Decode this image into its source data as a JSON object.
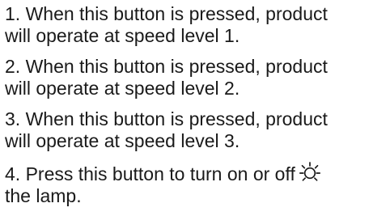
{
  "instructions": [
    {
      "line1": "1. When this button is pressed, product",
      "line2": "will  operate at speed level 1."
    },
    {
      "line1": "2. When this button is pressed, product",
      "line2": "will operate at speed level 2."
    },
    {
      "line1": "3. When this button is pressed, product",
      "line2": "will operate at speed level 3."
    },
    {
      "line1": "4. Press this button to turn on or off",
      "line2": "the lamp.",
      "icon": "lamp-icon"
    }
  ]
}
